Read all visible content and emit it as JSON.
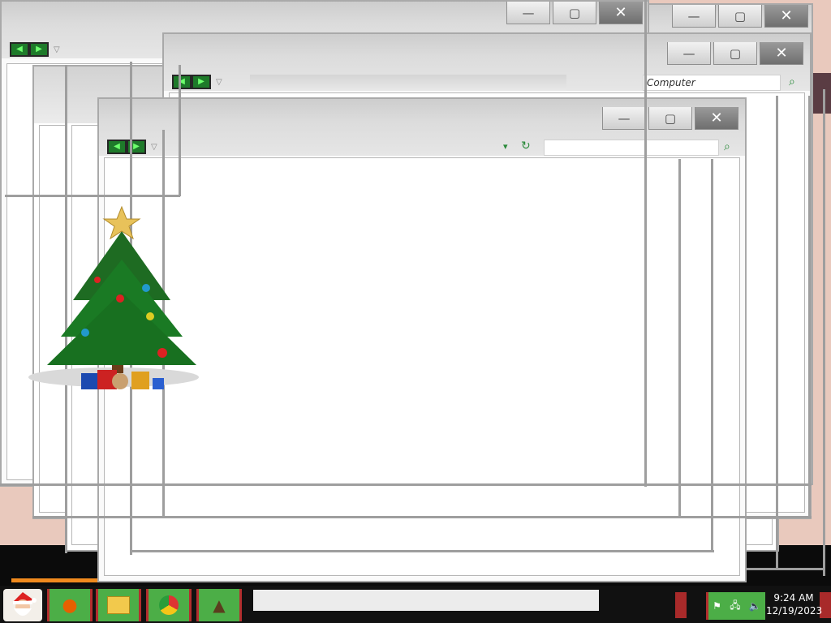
{
  "desktop": {
    "tree_name": "christmas-tree"
  },
  "window_controls": {
    "minimize": "—",
    "maximize": "▢",
    "close": "✕"
  },
  "nav": {
    "back": "◀",
    "forward": "▶",
    "dropdown": "▽"
  },
  "explorer": {
    "search_text": "Computer",
    "search_icon": "magnifier-icon"
  },
  "front_window": {
    "refresh_icon": "↻",
    "dropdown": "▾"
  },
  "taskbar": {
    "start_icon": "santa-icon",
    "apps": [
      {
        "name": "firefox-icon",
        "glyph": "🦊"
      },
      {
        "name": "folder-icon",
        "glyph": "📁"
      },
      {
        "name": "chrome-icon",
        "glyph": "◉"
      },
      {
        "name": "wizard-icon",
        "glyph": "🧙"
      }
    ],
    "tray": {
      "flag": "⚑",
      "network": "🖧",
      "volume": "🔈"
    },
    "clock": {
      "time": "9:24 AM",
      "date": "12/19/2023"
    }
  },
  "colors": {
    "taskbar_button": "#4cae47",
    "taskbar_border": "#b22e2e",
    "accent_orange": "#f08a1e"
  }
}
